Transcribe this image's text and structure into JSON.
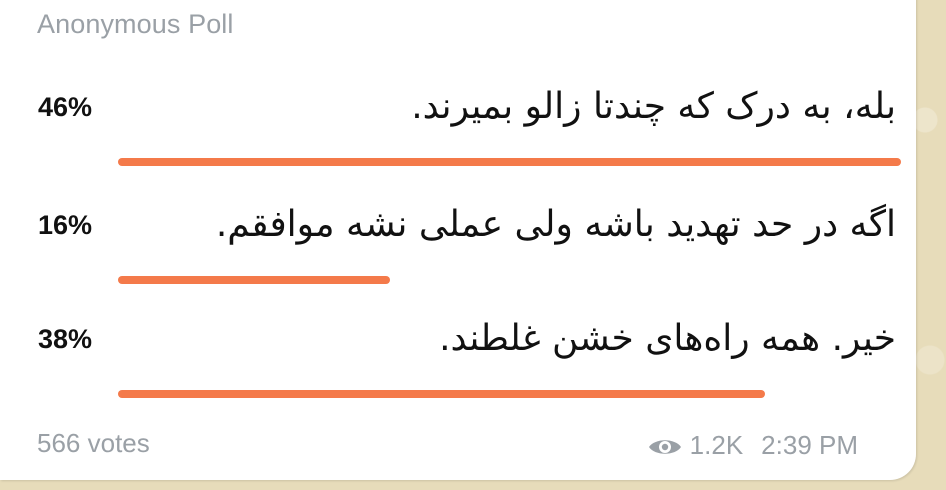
{
  "poll": {
    "title": "Anonymous Poll",
    "accent_color": "#f47a4a",
    "options": [
      {
        "percent_label": "46%",
        "percent": 46,
        "text": "بله، به درک که چندتا زالو بمیرند."
      },
      {
        "percent_label": "16%",
        "percent": 16,
        "text": "اگه در حد تهدید باشه ولی عملی نشه موافقم."
      },
      {
        "percent_label": "38%",
        "percent": 38,
        "text": "خیر. همه راه‌های خشن غلطند."
      }
    ],
    "votes": "566 votes"
  },
  "meta": {
    "views_icon": "eye-icon",
    "views": "1.2K",
    "time": "2:39 PM"
  }
}
